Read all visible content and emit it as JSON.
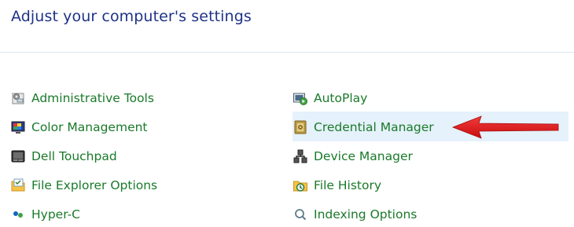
{
  "page": {
    "heading": "Adjust your computer's settings"
  },
  "items": {
    "left": [
      {
        "label": "Administrative Tools",
        "icon": "administrative-tools-icon"
      },
      {
        "label": "Color Management",
        "icon": "color-management-icon"
      },
      {
        "label": "Dell Touchpad",
        "icon": "dell-touchpad-icon"
      },
      {
        "label": "File Explorer Options",
        "icon": "file-explorer-options-icon"
      },
      {
        "label": "Hyper-C",
        "icon": "folder-icon"
      }
    ],
    "right": [
      {
        "label": "AutoPlay",
        "icon": "autoplay-icon"
      },
      {
        "label": "Credential Manager",
        "icon": "credential-manager-icon"
      },
      {
        "label": "Device Manager",
        "icon": "device-manager-icon"
      },
      {
        "label": "File History",
        "icon": "file-history-icon"
      },
      {
        "label": "Indexing Options",
        "icon": "indexing-options-icon"
      }
    ]
  },
  "annotation": {
    "arrow_color": "#e31a1a",
    "highlight_color": "#e5f1fb"
  }
}
